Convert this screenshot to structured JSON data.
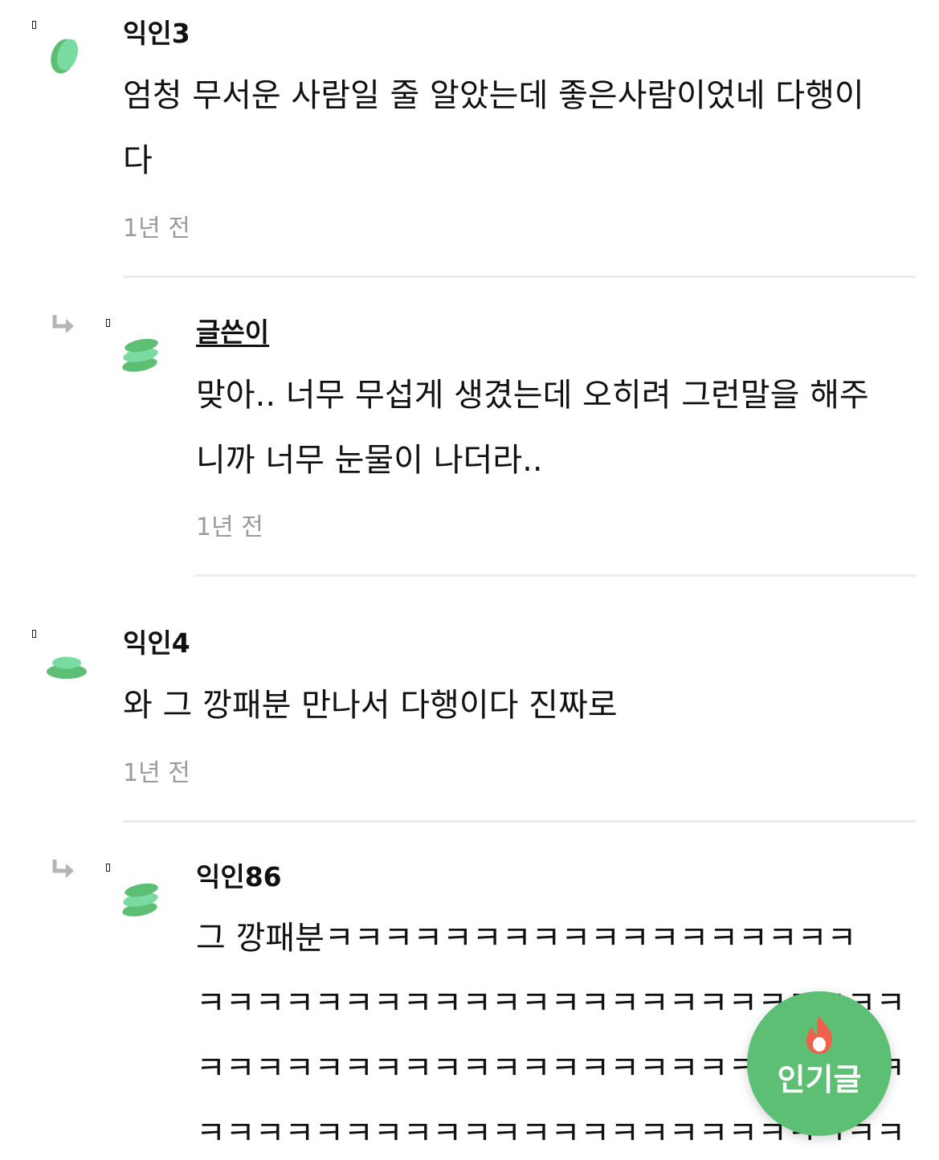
{
  "comments": [
    {
      "author": "익인3",
      "body": "엄청 무서운 사람일 줄 알았는데 좋은사람이었네 다행이\n다",
      "time": "1년 전"
    },
    {
      "author": "글쓴이",
      "body": "맞아.. 너무 무섭게 생겼는데 오히려 그런말을 해주\n니까 너무 눈물이 나더라..",
      "time": "1년 전"
    },
    {
      "author": "익인4",
      "body": "와 그 깡패분 만나서 다행이다 진짜로",
      "time": "1년 전"
    },
    {
      "author": "익인86",
      "body": "그 깡패분ㅋㅋㅋㅋㅋㅋㅋㅋㅋㅋㅋㅋㅋㅋㅋㅋㅋㅋ\nㅋㅋㅋㅋㅋㅋㅋㅋㅋㅋㅋㅋㅋㅋㅋㅋㅋㅋㅋㅋㅋㅋㅋㅋ\nㅋㅋㅋㅋㅋㅋㅋㅋㅋㅋㅋㅋㅋㅋㅋㅋㅋㅋㅋㅋㅋㅋㅋㅋ\nㅋㅋㅋㅋㅋㅋㅋㅋㅋㅋㅋㅋㅋㅋㅋㅋㅋㅋㅋㅋㅋㅋㅋㅋ"
    }
  ],
  "popular_button": {
    "label": "인기글",
    "icon": "fire-icon"
  },
  "colors": {
    "avatar_green": "#5cbf73",
    "avatar_mint": "#6dd39a",
    "fab": "#5cbf73",
    "fire": "#f0604a",
    "time_text": "#9a9a9a",
    "divider": "#ececec"
  }
}
